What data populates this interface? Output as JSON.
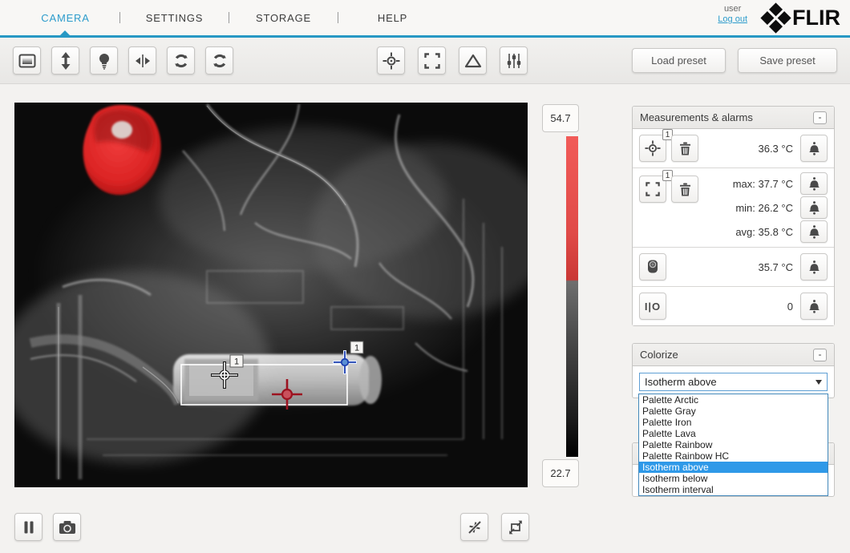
{
  "nav": {
    "items": [
      {
        "label": "CAMERA",
        "active": true
      },
      {
        "label": "SETTINGS",
        "active": false
      },
      {
        "label": "STORAGE",
        "active": false
      },
      {
        "label": "HELP",
        "active": false
      }
    ],
    "user_label": "user",
    "logout_label": "Log out",
    "brand": "FLIR"
  },
  "toolbar": {
    "load_preset_label": "Load preset",
    "save_preset_label": "Save preset"
  },
  "scale": {
    "max_label": "54.7",
    "min_label": "22.7"
  },
  "image": {
    "spot_marker_badge": "1",
    "box_marker_badge": "1"
  },
  "measurements_panel": {
    "title": "Measurements & alarms",
    "collapse_label": "-",
    "spot_row": {
      "badge": "1",
      "value": "36.3 °C"
    },
    "box_row": {
      "badge": "1",
      "max": "max: 37.7 °C",
      "min": "min: 26.2 °C",
      "avg": "avg: 35.8 °C"
    },
    "camera_row": {
      "value": "35.7 °C"
    },
    "io_row": {
      "icon_label": "I|O",
      "value": "0"
    }
  },
  "colorize_panel": {
    "title": "Colorize",
    "collapse_label": "-",
    "selected": "Isotherm above",
    "options": [
      "Palette Arctic",
      "Palette Gray",
      "Palette Iron",
      "Palette Lava",
      "Palette Rainbow",
      "Palette Rainbow HC",
      "Isotherm above",
      "Isotherm below",
      "Isotherm interval"
    ],
    "highlighted_option": "Isotherm above"
  },
  "colors": {
    "accent_blue": "#2d9ccc",
    "nav_line": "#2798c4",
    "dropdown_highlight": "#2f99e8",
    "isotherm_red": "#d93030",
    "scale_red": "#e04b48"
  }
}
